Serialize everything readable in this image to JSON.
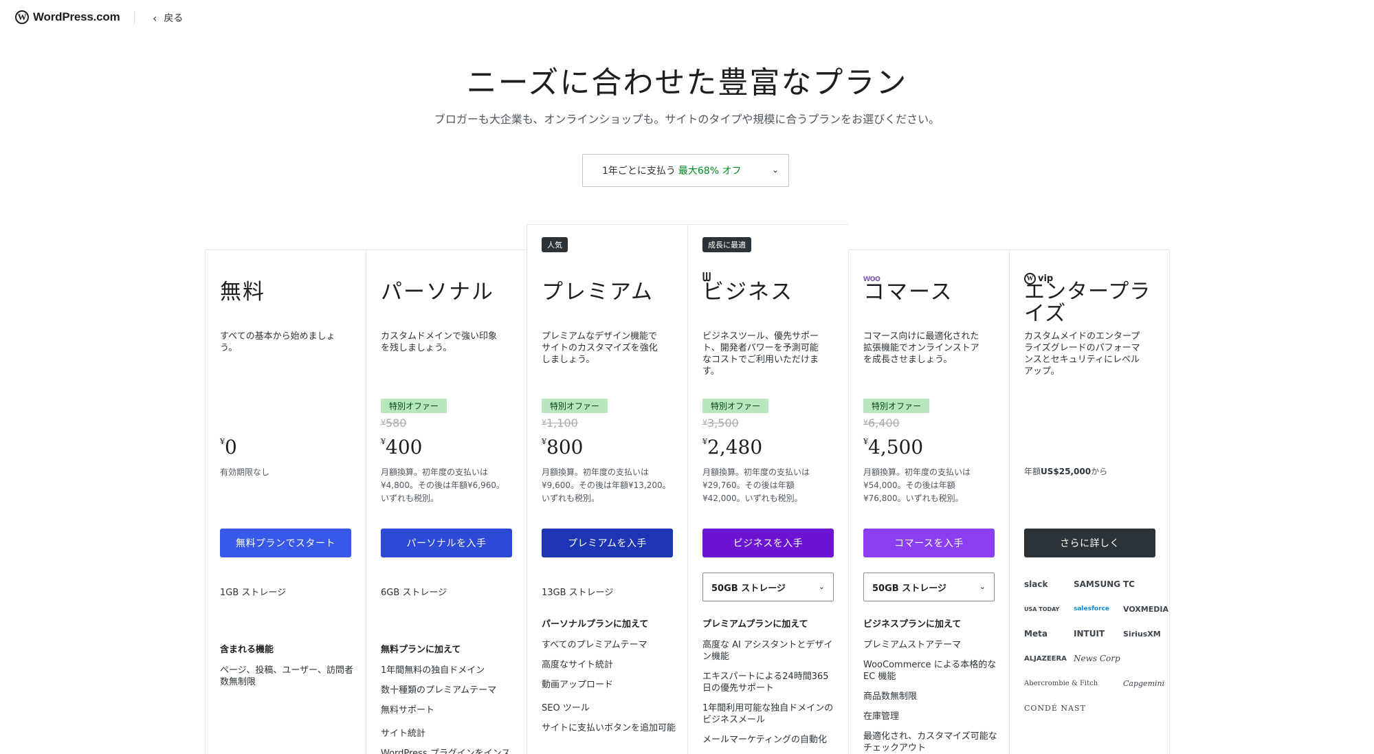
{
  "header": {
    "logo_text": "WordPress.com",
    "back_label": "戻る"
  },
  "hero": {
    "title": "ニーズに合わせた豊富なプラン",
    "subtitle": "ブロガーも大企業も、オンラインショップも。サイトのタイプや規模に合うプランをお選びください。"
  },
  "billing": {
    "label": "1年ごとに支払う",
    "savings": "最大68% オフ"
  },
  "colors": {
    "free_cta": "#3858e9",
    "personal_cta": "#2c4ad6",
    "premium_cta": "#1d35b4",
    "business_cta": "#6b14d1",
    "commerce_cta": "#8c3ff0",
    "enterprise_cta": "#2c3338"
  },
  "plans": [
    {
      "name": "無料",
      "desc": "すべての基本から始めましょう。",
      "price_currency": "¥",
      "price": "0",
      "price_note": "有効期限なし",
      "cta": "無料プランでスタート",
      "storage": "1GB ストレージ",
      "features_head": "含まれる機能",
      "features": [
        "ページ、投稿、ユーザー、訪問者数無制限"
      ]
    },
    {
      "name": "パーソナル",
      "desc": "カスタムドメインで強い印象を残しましょう。",
      "offer": "特別オファー",
      "orig_price": "580",
      "price_currency": "¥",
      "price": "400",
      "price_note": "月額換算。初年度の支払いは¥4,800。その後は年額¥6,960。いずれも税別。",
      "cta": "パーソナルを入手",
      "storage": "6GB ストレージ",
      "features_head": "無料プランに加えて",
      "features": [
        "1年間無料の独自ドメイン",
        "数十種類のプレミアムテーマ",
        "無料サポート",
        "サイト統計",
        "WordPress プラグインをインストール可能"
      ]
    },
    {
      "badge": "人気",
      "name": "プレミアム",
      "desc": "プレミアムなデザイン機能でサイトのカスタマイズを強化しましょう。",
      "offer": "特別オファー",
      "orig_price": "1,100",
      "price_currency": "¥",
      "price": "800",
      "price_note": "月額換算。初年度の支払いは¥9,600。その後は年額¥13,200。いずれも税別。",
      "cta": "プレミアムを入手",
      "storage": "13GB ストレージ",
      "features_head": "パーソナルプランに加えて",
      "features": [
        "すべてのプレミアムテーマ",
        "高度なサイト統計",
        "動画アップロード",
        "SEO ツール",
        "サイトに支払いボタンを追加可能"
      ]
    },
    {
      "badge": "成長に最適",
      "name": "ビジネス",
      "desc": "ビジネスツール、優先サポート、開発者パワーを予測可能なコストでご利用いただけます。",
      "offer": "特別オファー",
      "orig_price": "3,500",
      "price_currency": "¥",
      "price": "2,480",
      "price_note": "月額換算。初年度の支払いは¥29,760。その後は年額¥42,000。いずれも税別。",
      "cta": "ビジネスを入手",
      "storage": "50GB ストレージ",
      "features_head": "プレミアムプランに加えて",
      "features": [
        "高度な AI アシスタントとデザイン機能",
        "エキスパートによる24時間365日の優先サポート",
        "1年間利用可能な独自ドメインのビジネスメール",
        "メールマーケティングの自動化"
      ]
    },
    {
      "brand": "woo",
      "name": "コマース",
      "desc": "コマース向けに最適化された拡張機能でオンラインストアを成長させましょう。",
      "offer": "特別オファー",
      "orig_price": "6,400",
      "price_currency": "¥",
      "price": "4,500",
      "price_note": "月額換算。初年度の支払いは¥54,000。その後は年額¥76,800。いずれも税別。",
      "cta": "コマースを入手",
      "storage": "50GB ストレージ",
      "features_head": "ビジネスプランに加えて",
      "features": [
        "プレミアムストアテーマ",
        "WooCommerce による本格的な EC 機能",
        "商品数無制限",
        "在庫管理",
        "最適化され、カスタマイズ可能なチェックアウト"
      ]
    },
    {
      "brand": "vip",
      "name": "エンタープライズ",
      "desc": "カスタムメイドのエンタープライズグレードのパフォーマンスとセキュリティにレベルアップ。",
      "price_note_prefix": "年額",
      "price_note_amount": "US$25,000",
      "price_note_suffix": "から",
      "cta": "さらに詳しく",
      "client_logos": [
        "slack",
        "SAMSUNG",
        "TC",
        "USA TODAY",
        "salesforce",
        "VOXMEDIA",
        "Meta",
        "INTUIT",
        "SiriusXM",
        "ALJAZEERA",
        "News Corp",
        "Abercrombie & Fitch",
        "Capgemini",
        "CONDÉ NAST"
      ]
    }
  ]
}
